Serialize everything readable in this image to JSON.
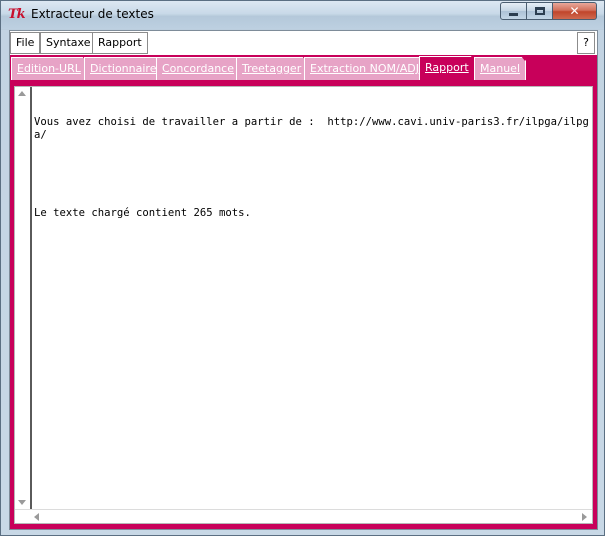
{
  "window": {
    "title": "Extracteur de textes",
    "icon_glyph": "Tk",
    "close_glyph": "✕"
  },
  "menu": {
    "items": [
      "File",
      "Syntaxe",
      "Rapport"
    ],
    "help_label": "?"
  },
  "tabs": [
    {
      "label": "Edition-URL",
      "active": false
    },
    {
      "label": "Dictionnaire",
      "active": false
    },
    {
      "label": "Concordance",
      "active": false
    },
    {
      "label": "Treetagger",
      "active": false
    },
    {
      "label": "Extraction NOM/ADJ",
      "active": false
    },
    {
      "label": "Rapport",
      "active": true
    },
    {
      "label": "Manuel",
      "active": false
    }
  ],
  "report": {
    "lines": [
      "Vous avez choisi de travailler a partir de :  http://www.cavi.univ-paris3.fr/ilpga/ilpga/",
      "",
      "Le texte chargé contient 265 mots."
    ]
  },
  "colors": {
    "tab_bar": "#c8005a",
    "tab_inactive": "#e7a3c6",
    "tab_text": "#ffffff",
    "close_button": "#c0452b"
  },
  "icons": {
    "app": "tk-feather-icon",
    "minimize": "minimize-icon",
    "maximize": "maximize-icon",
    "close": "close-icon"
  }
}
